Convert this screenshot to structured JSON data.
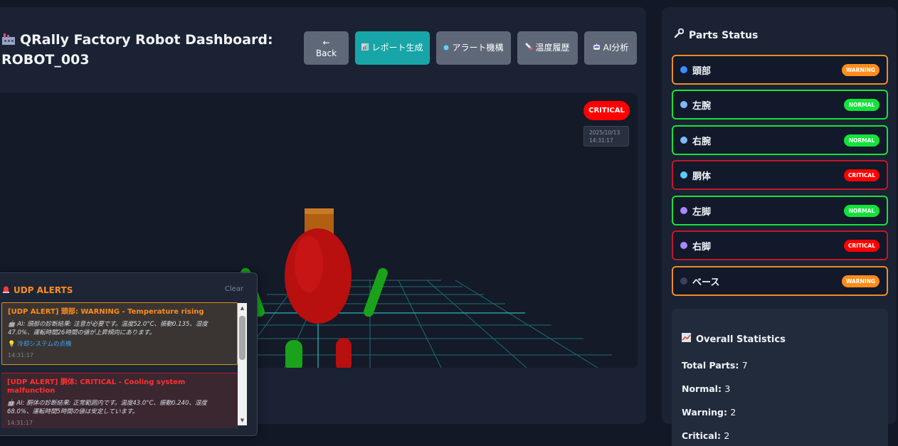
{
  "header": {
    "title": "QRally Factory Robot Dashboard: ROBOT_003",
    "buttons": {
      "back_arrow": "←",
      "back": "Back",
      "report": "レポート生成",
      "alert": "アラート機構",
      "temp": "温度履歴",
      "ai": "AI分析"
    }
  },
  "viewport": {
    "status_badge": "CRITICAL",
    "timestamp_date": "2025/10/13",
    "timestamp_time": "14:31:17"
  },
  "alerts": {
    "title": "UDP ALERTS",
    "clear": "Clear",
    "items": [
      {
        "level": "warning",
        "title": "[UDP ALERT] 頭部: WARNING - Temperature rising",
        "body": "AI: 頭部の診断結果: 注意が必要です。温度52.0°C、振動0.135、湿度47.0%、運転時間26時間の値が上昇傾向にあります。",
        "action": "冷却システムの点検",
        "time": "14:31:17"
      },
      {
        "level": "critical",
        "title": "[UDP ALERT] 胴体: CRITICAL - Cooling system malfunction",
        "body": "AI: 胴体の診断結果: 正常範囲内です。温度43.0°C、振動0.240、湿度68.0%、運転時間5時間の値は安定しています。",
        "time": "14:31:17"
      }
    ]
  },
  "parts": {
    "title": "Parts Status",
    "items": [
      {
        "name": "頭部",
        "status": "WARNING",
        "dot": "#3b8cff"
      },
      {
        "name": "左腕",
        "status": "NORMAL",
        "dot": "#7fb8ff"
      },
      {
        "name": "右腕",
        "status": "NORMAL",
        "dot": "#7fb8ff"
      },
      {
        "name": "胴体",
        "status": "CRITICAL",
        "dot": "#5fc8ff"
      },
      {
        "name": "左脚",
        "status": "NORMAL",
        "dot": "#a987ff"
      },
      {
        "name": "右脚",
        "status": "CRITICAL",
        "dot": "#a987ff"
      },
      {
        "name": "ベース",
        "status": "WARNING",
        "dot": "#3a4258"
      }
    ]
  },
  "stats": {
    "title": "Overall Statistics",
    "total_label": "Total Parts:",
    "total": "7",
    "normal_label": "Normal:",
    "normal": "3",
    "warning_label": "Warning:",
    "warning": "2",
    "critical_label": "Critical:",
    "critical": "2"
  },
  "colors": {
    "warning": "#ff8c1a",
    "normal": "#12e33a",
    "critical": "#ff0000",
    "accent": "#17a5a7"
  }
}
